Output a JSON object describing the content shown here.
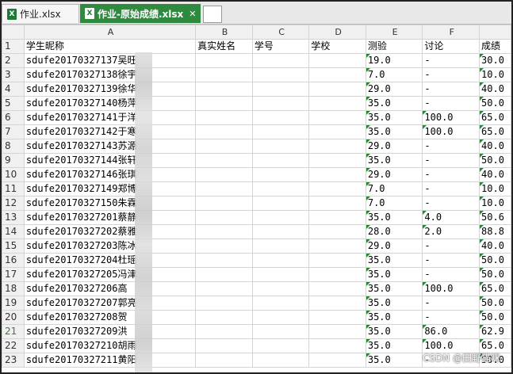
{
  "tabs": [
    {
      "icon": "X",
      "label": "作业.xlsx"
    },
    {
      "icon": "X",
      "label": "作业-原始成绩.xlsx",
      "close": "✕"
    }
  ],
  "columns": [
    "A",
    "B",
    "C",
    "D",
    "E",
    "F",
    ""
  ],
  "rows": [
    {
      "n": "1",
      "c": [
        "学生昵称",
        "真实姓名",
        "学号",
        "学校",
        "测验",
        "讨论",
        "成绩"
      ]
    },
    {
      "n": "2",
      "c": [
        "sdufe20170327137吴旺",
        "",
        "",
        "",
        "19.0",
        "-",
        "30.0"
      ]
    },
    {
      "n": "3",
      "c": [
        "sdufe20170327138徐宇",
        "",
        "",
        "",
        "7.0",
        "-",
        "10.0"
      ]
    },
    {
      "n": "4",
      "c": [
        "sdufe20170327139徐华",
        "",
        "",
        "",
        "29.0",
        "-",
        "40.0"
      ]
    },
    {
      "n": "5",
      "c": [
        "sdufe20170327140杨萍",
        "",
        "",
        "",
        "35.0",
        "-",
        "50.0"
      ]
    },
    {
      "n": "6",
      "c": [
        "sdufe20170327141于洋",
        "",
        "",
        "",
        "35.0",
        "100.0",
        "65.0"
      ]
    },
    {
      "n": "7",
      "c": [
        "sdufe20170327142于寒",
        "",
        "",
        "",
        "35.0",
        "100.0",
        "65.0"
      ]
    },
    {
      "n": "8",
      "c": [
        "sdufe20170327143苏源",
        "",
        "",
        "",
        "29.0",
        "-",
        "40.0"
      ]
    },
    {
      "n": "9",
      "c": [
        "sdufe20170327144张轩",
        "",
        "",
        "",
        "35.0",
        "-",
        "50.0"
      ]
    },
    {
      "n": "10",
      "c": [
        "sdufe20170327146张琪",
        "",
        "",
        "",
        "29.0",
        "-",
        "40.0"
      ]
    },
    {
      "n": "11",
      "c": [
        "sdufe20170327149郑博",
        "",
        "",
        "",
        "7.0",
        "-",
        "10.0"
      ]
    },
    {
      "n": "12",
      "c": [
        "sdufe20170327150朱霖",
        "",
        "",
        "",
        "7.0",
        "-",
        "10.0"
      ]
    },
    {
      "n": "13",
      "c": [
        "sdufe20170327201蔡静",
        "",
        "",
        "",
        "35.0",
        "4.0",
        "50.6"
      ]
    },
    {
      "n": "14",
      "c": [
        "sdufe20170327202蔡雅",
        "",
        "",
        "",
        "28.0",
        "2.0",
        "88.8"
      ]
    },
    {
      "n": "15",
      "c": [
        "sdufe20170327203陈冰",
        "",
        "",
        "",
        "29.0",
        "-",
        "40.0"
      ]
    },
    {
      "n": "16",
      "c": [
        "sdufe20170327204杜瑶",
        "",
        "",
        "",
        "35.0",
        "-",
        "50.0"
      ]
    },
    {
      "n": "17",
      "c": [
        "sdufe20170327205冯津",
        "",
        "",
        "",
        "35.0",
        "-",
        "50.0"
      ]
    },
    {
      "n": "18",
      "c": [
        "sdufe20170327206高",
        "",
        "",
        "",
        "35.0",
        "100.0",
        "65.0"
      ]
    },
    {
      "n": "19",
      "c": [
        "sdufe20170327207郭亮",
        "",
        "",
        "",
        "35.0",
        "-",
        "50.0"
      ]
    },
    {
      "n": "20",
      "c": [
        "sdufe20170327208贺",
        "",
        "",
        "",
        "35.0",
        "-",
        "50.0"
      ]
    },
    {
      "n": "21",
      "c": [
        "sdufe20170327209洪",
        "",
        "",
        "",
        "35.0",
        "86.0",
        "62.9"
      ]
    },
    {
      "n": "22",
      "c": [
        "sdufe20170327210胡雨",
        "",
        "",
        "",
        "35.0",
        "100.0",
        "65.0"
      ]
    },
    {
      "n": "23",
      "c": [
        "sdufe20170327211黄阳",
        "",
        "",
        "",
        "35.0",
        "-",
        "50.0"
      ]
    }
  ],
  "watermark": "CSDN @田野猫咪"
}
